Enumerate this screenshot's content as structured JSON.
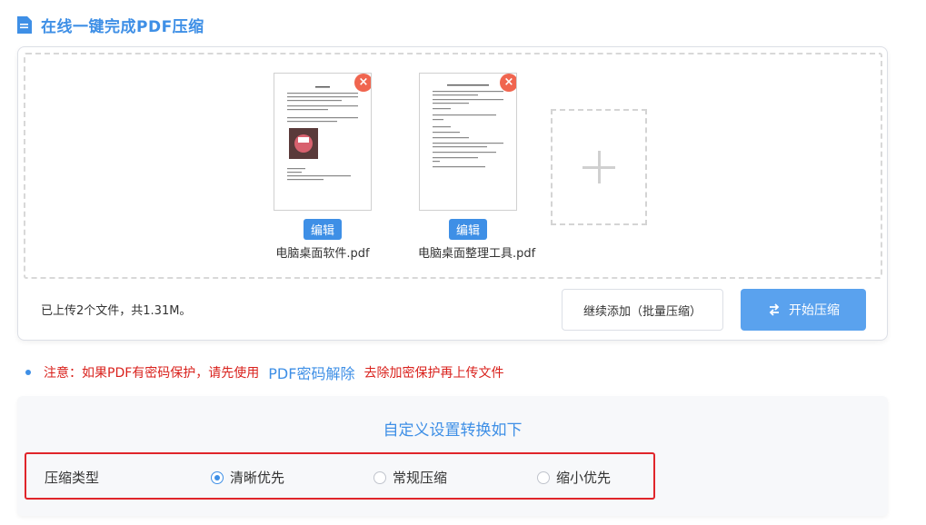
{
  "header": {
    "title": "在线一键完成PDF压缩",
    "icon": "document-icon"
  },
  "files": [
    {
      "name": "电脑桌面软件.pdf",
      "edit_label": "编辑",
      "remove": "×"
    },
    {
      "name": "电脑桌面整理工具.pdf",
      "edit_label": "编辑",
      "remove": "×"
    }
  ],
  "status": "已上传2个文件，共1.31M。",
  "buttons": {
    "continue": "继续添加（批量压缩）",
    "start": "开始压缩"
  },
  "note": {
    "prefix": "注意：如果PDF有密码保护，请先使用",
    "link": "PDF密码解除",
    "suffix": "去除加密保护再上传文件"
  },
  "settings": {
    "title": "自定义设置转换如下",
    "label": "压缩类型",
    "options": [
      {
        "label": "清晰优先",
        "checked": true
      },
      {
        "label": "常规压缩",
        "checked": false
      },
      {
        "label": "缩小优先",
        "checked": false
      }
    ]
  },
  "colors": {
    "accent": "#3e8fe6",
    "danger": "#f0654f",
    "warning_text": "#d9211c",
    "highlight_border": "#e0252a"
  }
}
